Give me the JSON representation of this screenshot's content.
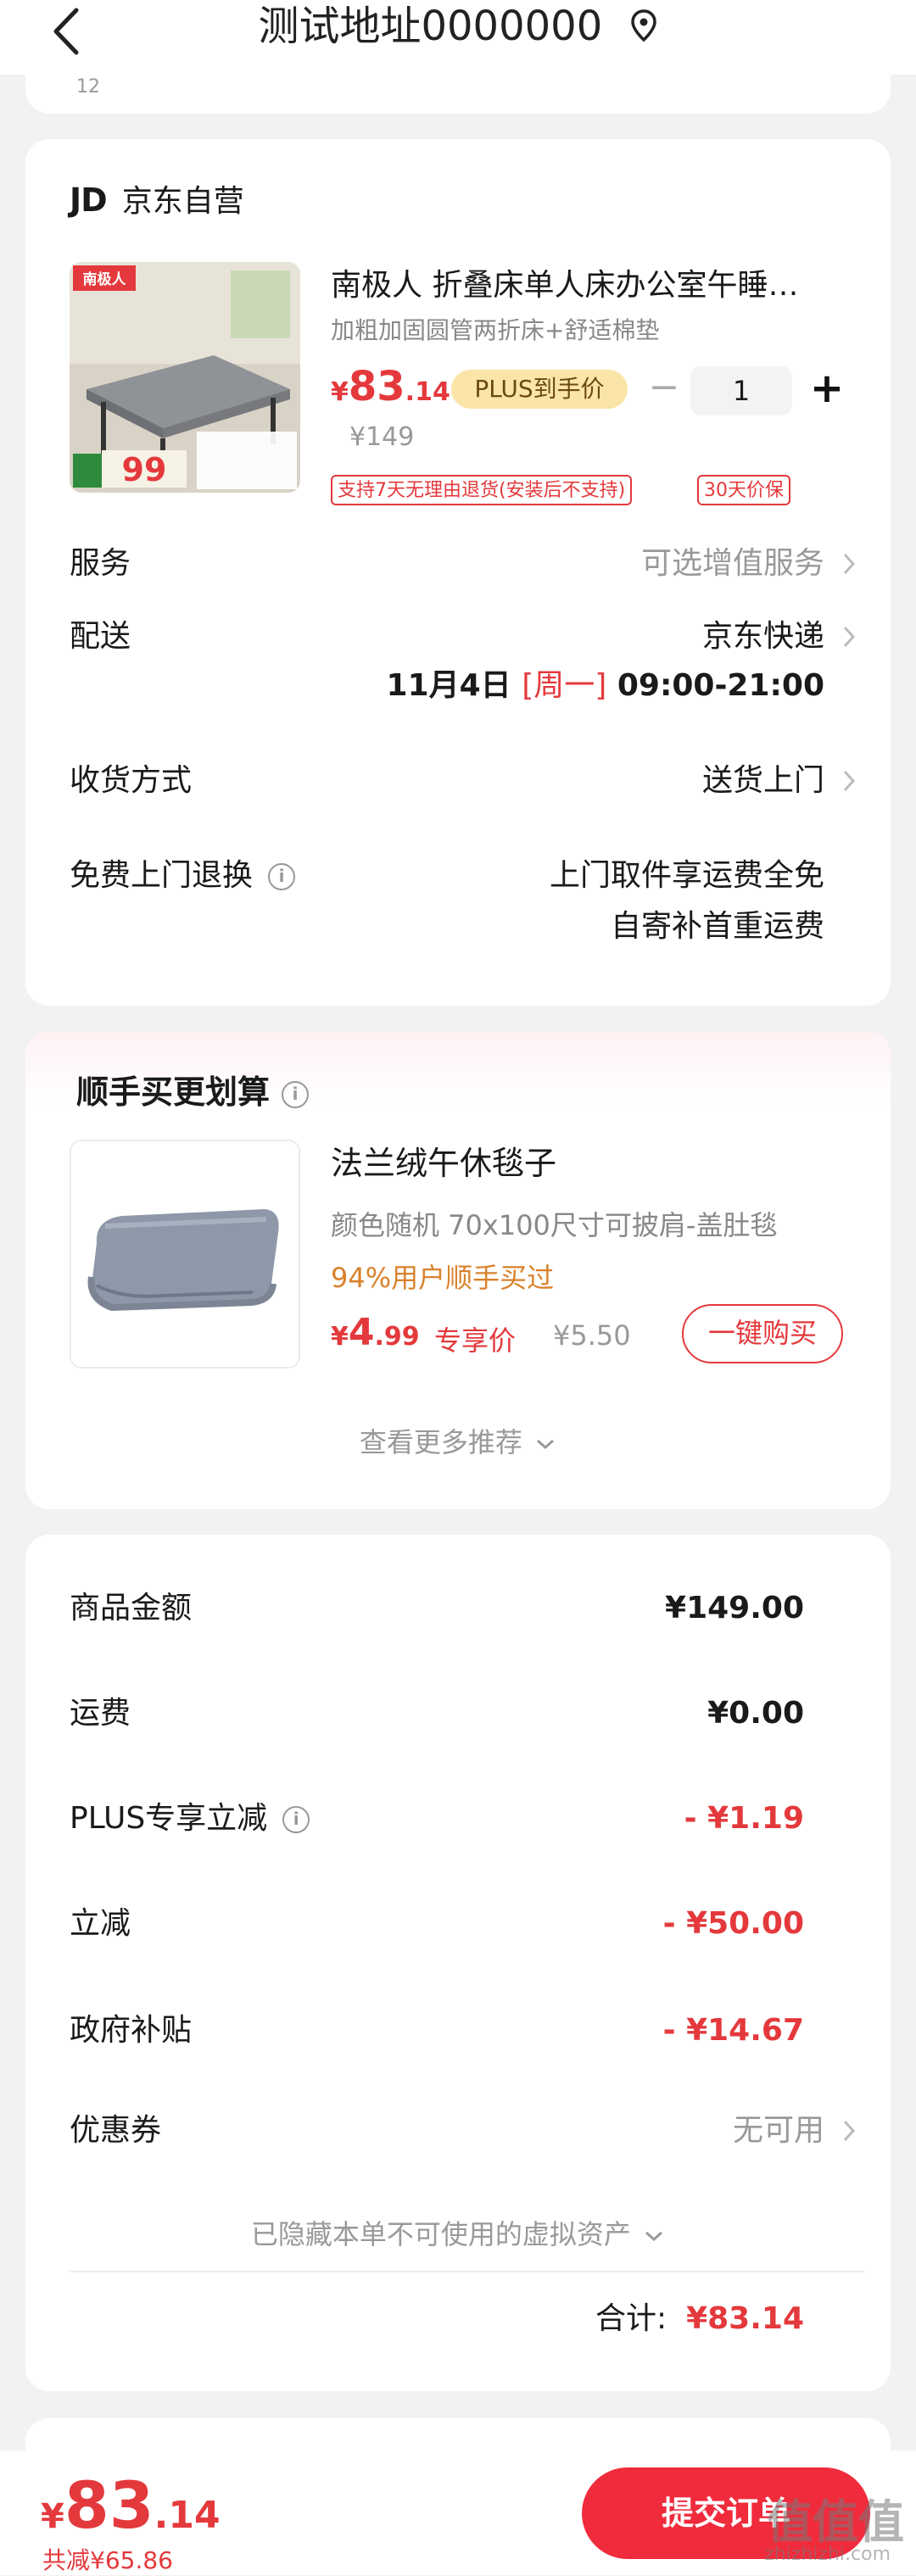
{
  "header": {
    "title": "测试地址0000000",
    "address_fragment": "12"
  },
  "order": {
    "shop": {
      "logo_text": "JD",
      "name": "京东自营"
    },
    "product": {
      "name": "南极人 折叠床单人床办公室午睡…",
      "spec": "加粗加固圆管两折床+舒适棉垫",
      "price_symbol": "¥",
      "price_int": "83",
      "price_dec": ".14",
      "plus_badge": "PLUS到手价",
      "original_price": "¥149",
      "quantity": "1",
      "qty_minus": "−",
      "qty_plus": "+",
      "tags": [
        "支持7天无理由退货(安装后不支持)",
        "30天价保"
      ],
      "image_brand": "南极人",
      "image_price": "99"
    },
    "service": {
      "label": "服务",
      "value": "可选增值服务"
    },
    "delivery": {
      "label": "配送",
      "carrier": "京东快递",
      "date": "11月4日",
      "weekday": "[周一]",
      "time": "09:00-21:00"
    },
    "receive_method": {
      "label": "收货方式",
      "value": "送货上门"
    },
    "free_return": {
      "label": "免费上门退换",
      "line1": "上门取件享运费全免",
      "line2": "自寄补首重运费"
    }
  },
  "recommend": {
    "title": "顺手买更划算",
    "item": {
      "name": "法兰绒午休毯子",
      "desc": "颜色随机   70x100尺寸可披肩-盖肚毯",
      "social": "94%用户顺手买过",
      "price_symbol": "¥",
      "price_int": "4",
      "price_dec": ".99",
      "exclusive_label": "专享价",
      "original_price": "¥5.50",
      "buy_label": "一键购买"
    },
    "more_label": "查看更多推荐"
  },
  "summary": {
    "rows": [
      {
        "label": "商品金额",
        "value": "¥149.00"
      },
      {
        "label": "运费",
        "value": "¥0.00"
      },
      {
        "label": "PLUS专享立减",
        "value": "- ¥1.19"
      },
      {
        "label": "立减",
        "value": "- ¥50.00"
      },
      {
        "label": "政府补贴",
        "value": "- ¥14.67"
      }
    ],
    "coupon": {
      "label": "优惠券",
      "value": "无可用"
    },
    "hidden_assets": "已隐藏本单不可使用的虚拟资产",
    "total_label": "合计:",
    "total_value": "¥83.14"
  },
  "bottom": {
    "price_symbol": "¥",
    "price_int": "83",
    "price_dec": ".14",
    "saving": "共减¥65.86",
    "submit_label": "提交订单",
    "watermark": "值值值",
    "watermark_sub": "zhizhizhi.com"
  },
  "colors": {
    "accent": "#e4393c",
    "plus_badge": "#fbe4a8",
    "social": "#d9822b",
    "submit": "#f02b3c"
  },
  "icons": [
    "back-arrow-icon",
    "location-pin-icon",
    "chevron-right-icon",
    "info-icon",
    "chevron-down-icon"
  ]
}
